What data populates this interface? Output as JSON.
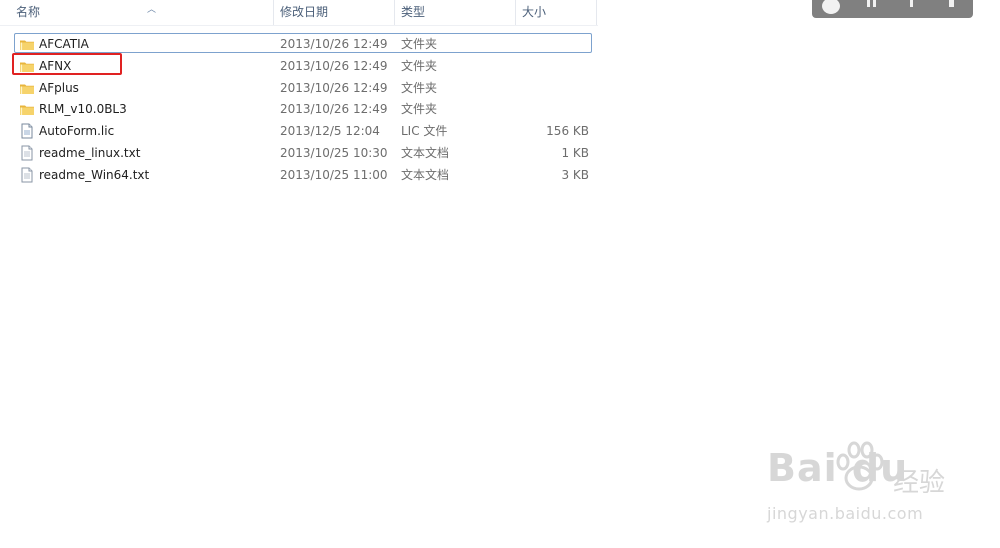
{
  "columns": {
    "name": "名称",
    "date": "修改日期",
    "type": "类型",
    "size": "大小"
  },
  "files": [
    {
      "name": "AFCATIA",
      "date": "2013/10/26 12:49",
      "type": "文件夹",
      "size": "",
      "icon": "folder-icon"
    },
    {
      "name": "AFNX",
      "date": "2013/10/26 12:49",
      "type": "文件夹",
      "size": "",
      "icon": "folder-icon"
    },
    {
      "name": "AFplus",
      "date": "2013/10/26 12:49",
      "type": "文件夹",
      "size": "",
      "icon": "folder-icon"
    },
    {
      "name": "RLM_v10.0BL3",
      "date": "2013/10/26 12:49",
      "type": "文件夹",
      "size": "",
      "icon": "folder-icon"
    },
    {
      "name": "AutoForm.lic",
      "date": "2013/12/5 12:04",
      "type": "LIC 文件",
      "size": "156 KB",
      "icon": "lic-file-icon"
    },
    {
      "name": "readme_linux.txt",
      "date": "2013/10/25 10:30",
      "type": "文本文档",
      "size": "1 KB",
      "icon": "text-file-icon"
    },
    {
      "name": "readme_Win64.txt",
      "date": "2013/10/25 11:00",
      "type": "文本文档",
      "size": "3 KB",
      "icon": "text-file-icon"
    }
  ],
  "watermark": {
    "brand": "Bai du",
    "brand_cn": "经验",
    "url": "jingyan.baidu.com"
  },
  "colors": {
    "highlight": "#e02222",
    "selection_border": "#7da2ce",
    "header_text": "#4c607a"
  }
}
